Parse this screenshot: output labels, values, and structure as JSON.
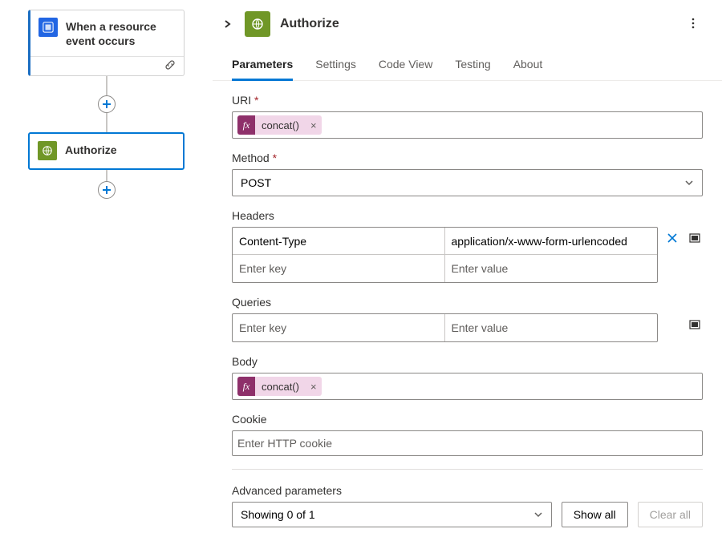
{
  "canvas": {
    "trigger": {
      "title": "When a resource event occurs"
    },
    "action": {
      "title": "Authorize"
    }
  },
  "panel": {
    "title": "Authorize",
    "tabs": [
      "Parameters",
      "Settings",
      "Code View",
      "Testing",
      "About"
    ],
    "active_tab_index": 0,
    "fields": {
      "uri": {
        "label": "URI",
        "pill": "concat()"
      },
      "method": {
        "label": "Method",
        "value": "POST"
      },
      "headers": {
        "label": "Headers",
        "rows": [
          {
            "key": "Content-Type",
            "value": "application/x-www-form-urlencoded"
          }
        ],
        "key_placeholder": "Enter key",
        "value_placeholder": "Enter value"
      },
      "queries": {
        "label": "Queries",
        "key_placeholder": "Enter key",
        "value_placeholder": "Enter value"
      },
      "body": {
        "label": "Body",
        "pill": "concat()"
      },
      "cookie": {
        "label": "Cookie",
        "placeholder": "Enter HTTP cookie"
      },
      "advanced": {
        "label": "Advanced parameters",
        "summary": "Showing 0 of 1",
        "show_all": "Show all",
        "clear_all": "Clear all"
      }
    }
  }
}
